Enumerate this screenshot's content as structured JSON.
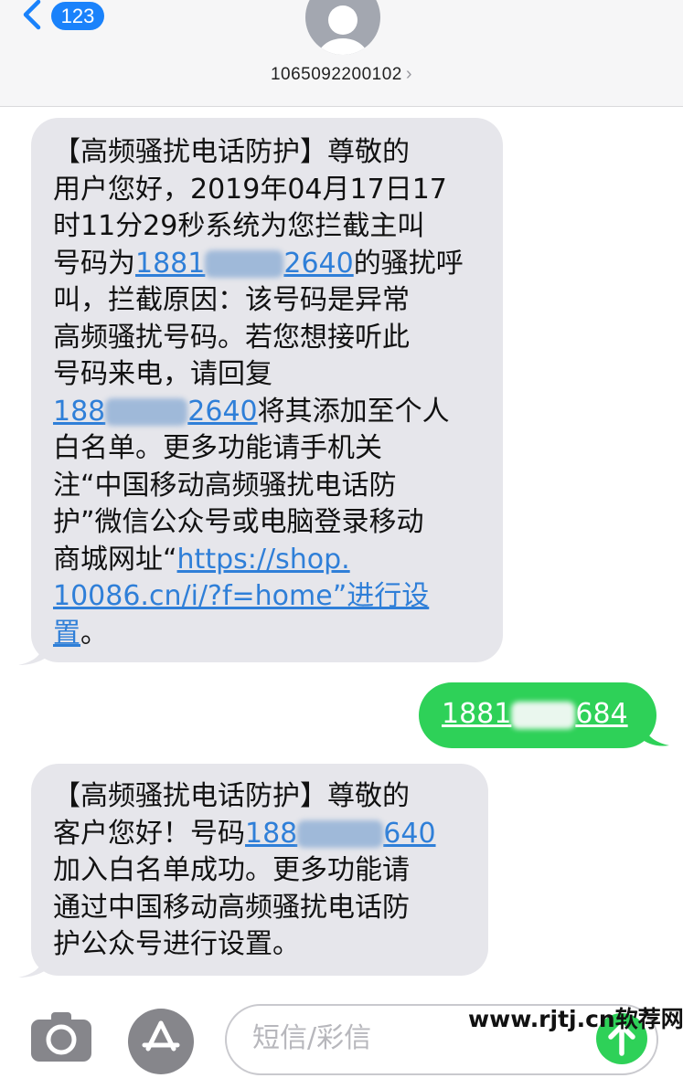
{
  "header": {
    "back_count": "123",
    "contact_number": "1065092200102",
    "contact_arrow": "›"
  },
  "messages": [
    {
      "direction": "incoming",
      "lines": [
        [
          "【高频骚扰电话防护】尊敬的"
        ],
        [
          "用户您好，2019年04月17日17"
        ],
        [
          "时11分29秒系统为您拦截主叫"
        ],
        [
          "号码为",
          {
            "link": "1881"
          },
          {
            "blur": true
          },
          {
            "link": "2640"
          },
          "的骚扰呼"
        ],
        [
          "叫，拦截原因：该号码是异常"
        ],
        [
          "高频骚扰号码。若您想接听此"
        ],
        [
          "号码来电，请回复"
        ],
        [
          {
            "link": "188"
          },
          {
            "blur": true
          },
          {
            "link": "2640"
          },
          "将其添加至个人"
        ],
        [
          "白名单。更多功能请手机关"
        ],
        [
          "注“中国移动高频骚扰电话防"
        ],
        [
          "护”微信公众号或电脑登录移动"
        ],
        [
          "商城网址“",
          {
            "link": "https://shop."
          }
        ],
        [
          {
            "link": "10086.cn/i/?f=home”进行设"
          }
        ],
        [
          {
            "link": "置"
          },
          "。"
        ]
      ]
    },
    {
      "direction": "outgoing",
      "lines": [
        [
          {
            "link": "1881"
          },
          {
            "blur": true
          },
          {
            "link": "684"
          }
        ]
      ]
    },
    {
      "direction": "incoming",
      "lines": [
        [
          "【高频骚扰电话防护】尊敬的"
        ],
        [
          "客户您好！号码",
          {
            "link": "188"
          },
          {
            "blur": true
          },
          {
            "link": "640"
          }
        ],
        [
          "加入白名单成功。更多功能请"
        ],
        [
          "通过中国移动高频骚扰电话防"
        ],
        [
          "护公众号进行设置。"
        ]
      ]
    }
  ],
  "input_bar": {
    "placeholder": "短信/彩信"
  },
  "watermark": "www.rjtj.cn软荐网",
  "colors": {
    "incoming_bubble": "#e6e6eb",
    "outgoing_bubble": "#2ed158",
    "link": "#2f7fd8",
    "badge": "#1a82fb"
  },
  "icons": [
    "chevron-left-icon",
    "avatar-icon",
    "camera-icon",
    "app-store-icon",
    "send-arrow-icon"
  ]
}
